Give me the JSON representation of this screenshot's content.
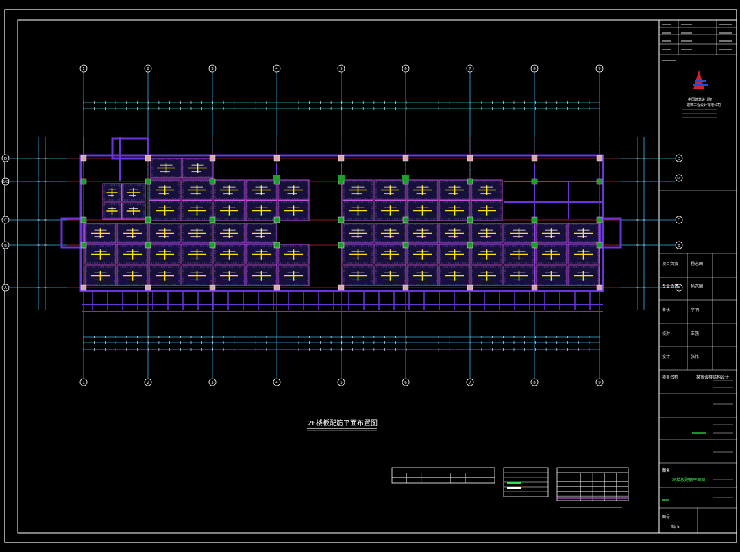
{
  "sheet": {
    "title": "2F楼板配筋平面布置图",
    "colors": {
      "background": "#000000",
      "frame": "#ffffff",
      "axis": "#3bb2e6",
      "grid_line": "#c0282c",
      "beam": "#6a35d8",
      "slab_outline": "#c050e0",
      "rebar": "#ffe400",
      "column": "#1f9e2e"
    }
  },
  "grid": {
    "column_labels": [
      "1",
      "2",
      "3",
      "4",
      "5",
      "6",
      "7",
      "8",
      "9"
    ],
    "row_labels": [
      "D",
      "(1/C)",
      "C",
      "B",
      "A"
    ]
  },
  "title_block": {
    "logo_icon": "company-logo",
    "company_line1": "中国建筑设计院",
    "company_line2": "建筑工程设计有限公司",
    "fields": [
      {
        "label": "项目负责",
        "value": "杨志国"
      },
      {
        "label": "专业负责",
        "value": "杨志国"
      },
      {
        "label": "审核",
        "value": "李明"
      },
      {
        "label": "校对",
        "value": "王强"
      },
      {
        "label": "设计",
        "value": "张伟"
      }
    ],
    "project_label": "项目名称",
    "project_value": "某宿舍楼结构设计",
    "drawing_label": "图名",
    "drawing_value": "2F楼板配筋平面图",
    "sheet_label": "图号",
    "sheet_value": "结-5"
  }
}
